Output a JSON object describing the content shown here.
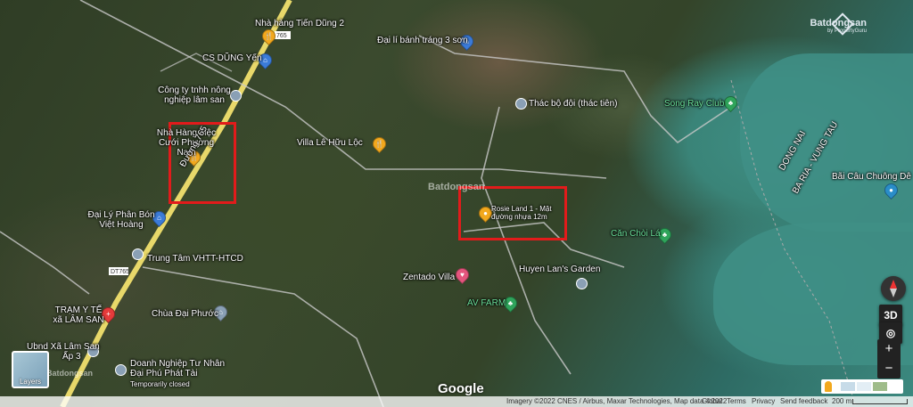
{
  "brand": {
    "name": "Batdongsan",
    "sub": "by PropertyGuru",
    "icon": "batdongsan-logo-icon"
  },
  "watermarks": {
    "center": "Batdongsan",
    "bottom_left": "Batdongsan"
  },
  "labels": {
    "nha_hang_tien_dung": "Nhà hàng Tiến Dũng 2",
    "dai_li_banh_trang": "Đại lí bánh tráng 3 sơn",
    "cs_dung_yen": "CS DŨNG Yến",
    "cong_ty": "Công ty tnhh nông nghiệp lâm san",
    "thac_bo_doi": "Thác bộ đội (thác tiên)",
    "song_ray_club": "Song Ray Club",
    "nha_hang_tiec": "Nhà Hàng Tiệc Cưới Phương Nam",
    "duong_road": "Đường 765",
    "villa_le_huu_loc": "Villa Lê Hữu Lộc",
    "dong_nai": "DONG NAI",
    "ba_ria_vung_tau": "BA RIA - VUNG TAU",
    "bai_cau": "Bãi Câu Chuông Dê",
    "dai_ly_phan_bon": "Đại Lý Phân Bón Việt Hoàng",
    "rosie_land": "Rosie Land 1 - Mặt đường nhựa 12m",
    "can_choi_la": "Căn Chòi Lá",
    "trung_tam": "Trung Tâm VHTT-HTCD",
    "huyen_lans": "Huyen Lan's Garden",
    "zentado": "Zentado Villa",
    "tram_y_te": "TRẠM Y TẾ xã LÂM SAN",
    "av_farm": "AV FARM",
    "chua_dai_phuoc": "Chùa Đại Phước",
    "ubnd": "Ubnd Xã Lâm San",
    "ap3": "Ấp 3",
    "doanh_nghiep": "Doanh Nghiệp Tư Nhân Đại Phú Phát Tài",
    "temporarily_closed": "Temporarily closed",
    "route_765_top": "765",
    "route_765_bottom": "DT765"
  },
  "controls": {
    "layers": "Layers",
    "three_d": "3D",
    "zoom_in": "+",
    "zoom_out": "−",
    "compass_icon": "compass-icon",
    "location_icon": "my-location-icon",
    "pegman_icon": "pegman-icon"
  },
  "google_logo": "Google",
  "footer": {
    "imagery": "Imagery ©2022 CNES / Airbus, Maxar Technologies, Map data ©2022",
    "global": "Global",
    "terms": "Terms",
    "privacy": "Privacy",
    "feedback": "Send feedback",
    "scale": "200 m"
  },
  "colors": {
    "highlight_box": "#e21b1b",
    "water": "#3f8f86",
    "road": "#e8d86a"
  }
}
